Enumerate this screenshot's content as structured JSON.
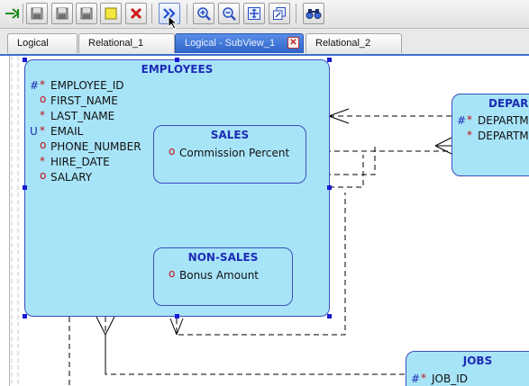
{
  "toolbar": {
    "buttons": [
      {
        "name": "go-icon"
      },
      {
        "name": "save-icon"
      },
      {
        "name": "save-all-icon"
      },
      {
        "name": "print-icon"
      },
      {
        "name": "new-note-icon"
      },
      {
        "name": "delete-icon"
      },
      {
        "name": "engineer-icon"
      },
      {
        "name": "zoom-in-icon"
      },
      {
        "name": "zoom-out-icon"
      },
      {
        "name": "fit-screen-icon"
      },
      {
        "name": "default-size-icon"
      },
      {
        "name": "find-icon"
      }
    ]
  },
  "tabs": [
    {
      "label": "Logical",
      "active": false
    },
    {
      "label": "Relational_1",
      "active": false
    },
    {
      "label": "Logical - SubView_1",
      "active": true
    },
    {
      "label": "Relational_2",
      "active": false
    }
  ],
  "diagram": {
    "employees": {
      "title": "EMPLOYEES",
      "attributes": [
        {
          "prefix": "#",
          "mark": "*",
          "name": "EMPLOYEE_ID"
        },
        {
          "prefix": "",
          "mark": "o",
          "name": "FIRST_NAME"
        },
        {
          "prefix": "",
          "mark": "*",
          "name": "LAST_NAME"
        },
        {
          "prefix": "U",
          "mark": "*",
          "name": "EMAIL"
        },
        {
          "prefix": "",
          "mark": "o",
          "name": "PHONE_NUMBER"
        },
        {
          "prefix": "",
          "mark": "*",
          "name": "HIRE_DATE"
        },
        {
          "prefix": "",
          "mark": "o",
          "name": "SALARY"
        }
      ]
    },
    "sales": {
      "title": "SALES",
      "attributes": [
        {
          "mark": "o",
          "name": "Commission Percent"
        }
      ]
    },
    "non_sales": {
      "title": "NON-SALES",
      "attributes": [
        {
          "mark": "o",
          "name": "Bonus Amount"
        }
      ]
    },
    "departments": {
      "title": "DEPAR",
      "attributes": [
        {
          "prefix": "#",
          "mark": "*",
          "name": "DEPARTM"
        },
        {
          "prefix": "",
          "mark": "*",
          "name": "DEPARTM"
        }
      ]
    },
    "jobs": {
      "title": "JOBS",
      "attributes": [
        {
          "prefix": "#",
          "mark": "*",
          "name": "JOB_ID"
        }
      ]
    }
  },
  "colors": {
    "entity_fill": "#a8e4f8",
    "entity_border": "#3a4fbd",
    "title_text": "#1c2bb5",
    "mandatory_mark": "#c01010",
    "selection_handle": "#1a1ad6",
    "active_tab": "#2d63c8"
  }
}
